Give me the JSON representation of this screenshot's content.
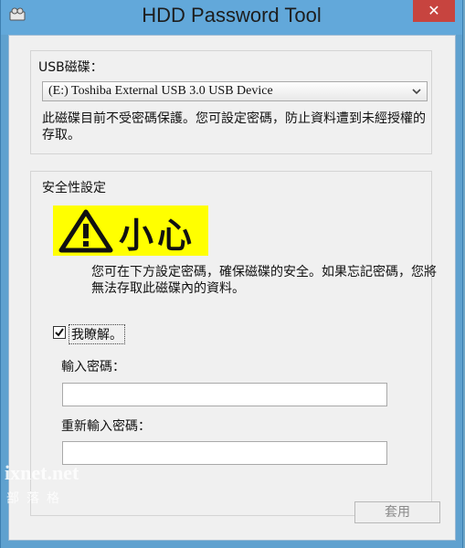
{
  "window": {
    "title": "HDD Password Tool",
    "close_glyph": "✕"
  },
  "usb_group": {
    "label": "USB磁碟：",
    "device_selected": "(E:) Toshiba External USB 3.0 USB Device",
    "info": "此磁碟目前不受密碼保護。您可設定密碼，防止資料遭到未經授權的存取。"
  },
  "security_group": {
    "label": "安全性設定",
    "caution_title": "小心",
    "warning_text": "您可在下方設定密碼，確保磁碟的安全。如果忘記密碼，您將無法存取此磁碟內的資料。",
    "checkbox_label": "我瞭解。",
    "checkbox_checked": true,
    "password_label": "輸入密碼：",
    "password_value": "",
    "confirm_label": "重新輸入密碼：",
    "confirm_value": ""
  },
  "buttons": {
    "apply": "套用"
  },
  "watermark": {
    "line1": "ixnet.net",
    "line2": "部落格"
  },
  "icons": {
    "app": "app-icon",
    "warning": "warning-triangle-icon",
    "dropdown": "chevron-down-icon",
    "check": "checkmark-icon"
  },
  "colors": {
    "titlebar": "#62a8da",
    "close": "#c7443f",
    "caution_bg": "#ffff00"
  }
}
